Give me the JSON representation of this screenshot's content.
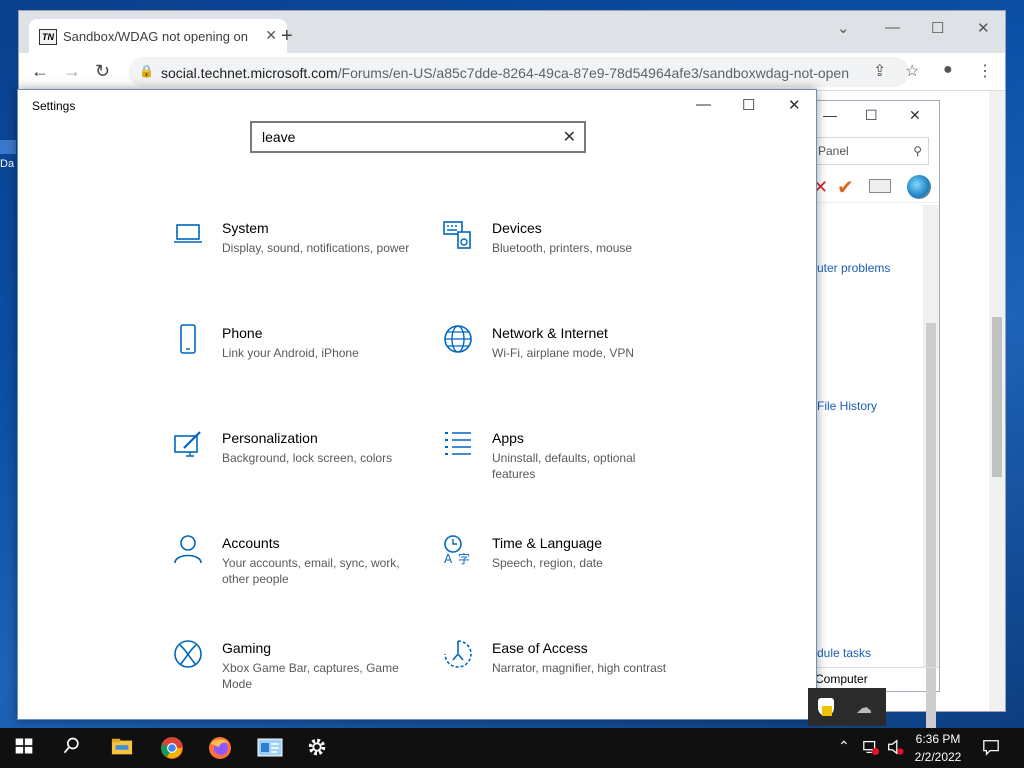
{
  "desktop": {
    "fragment_label": "Da"
  },
  "browser": {
    "tab_title": "Sandbox/WDAG not opening on",
    "tab_favicon_text": "TN",
    "url_host": "social.technet.microsoft.com",
    "url_path": "/Forums/en-US/a85c7dde-8264-49ca-87e9-78d54964afe3/sandboxwdag-not-open"
  },
  "control_panel": {
    "search_text": "Panel",
    "links": [
      "uter problems",
      "File History",
      "dule tasks"
    ],
    "footer": "Computer"
  },
  "settings": {
    "title": "Settings",
    "search_value": "leave",
    "categories": [
      {
        "name": "System",
        "desc": "Display, sound, notifications, power",
        "icon": "laptop-icon"
      },
      {
        "name": "Devices",
        "desc": "Bluetooth, printers, mouse",
        "icon": "keyboard-speaker-icon"
      },
      {
        "name": "Phone",
        "desc": "Link your Android, iPhone",
        "icon": "phone-icon"
      },
      {
        "name": "Network & Internet",
        "desc": "Wi-Fi, airplane mode, VPN",
        "icon": "globe-icon"
      },
      {
        "name": "Personalization",
        "desc": "Background, lock screen, colors",
        "icon": "paintbrush-icon"
      },
      {
        "name": "Apps",
        "desc": "Uninstall, defaults, optional features",
        "icon": "app-list-icon"
      },
      {
        "name": "Accounts",
        "desc": "Your accounts, email, sync, work, other people",
        "icon": "person-icon"
      },
      {
        "name": "Time & Language",
        "desc": "Speech, region, date",
        "icon": "time-language-icon"
      },
      {
        "name": "Gaming",
        "desc": "Xbox Game Bar, captures, Game Mode",
        "icon": "xbox-icon"
      },
      {
        "name": "Ease of Access",
        "desc": "Narrator, magnifier, high contrast",
        "icon": "ease-of-access-icon"
      }
    ]
  },
  "taskbar": {
    "time": "6:36 PM",
    "date": "2/2/2022",
    "pinned": [
      "start-icon",
      "search-icon",
      "file-explorer-icon",
      "chrome-icon",
      "firefox-icon",
      "control-panel-icon",
      "settings-gear-icon"
    ]
  },
  "colors": {
    "accent": "#0067c0",
    "taskbar": "#101010",
    "desktop": "#0b4fa6"
  }
}
